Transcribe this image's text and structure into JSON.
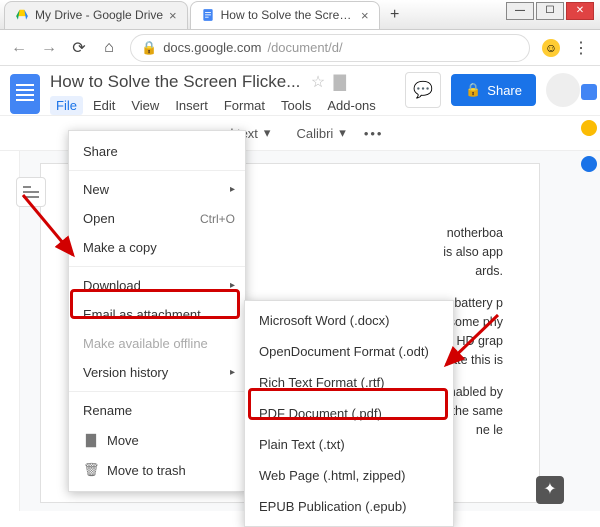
{
  "window": {
    "tabs": [
      {
        "title": "My Drive - Google Drive"
      },
      {
        "title": "How to Solve the Screen Flick"
      }
    ],
    "url_host": "docs.google.com",
    "url_path": "/document/d/"
  },
  "doc": {
    "title": "How to Solve the Screen Flicke...",
    "menus": [
      "File",
      "Edit",
      "View",
      "Insert",
      "Format",
      "Tools",
      "Add-ons"
    ],
    "share": "Share",
    "toolbar_style": "nal text",
    "toolbar_font": "Calibri"
  },
  "filemenu": {
    "share": "Share",
    "new": "New",
    "open": "Open",
    "open_shortcut": "Ctrl+O",
    "copy": "Make a copy",
    "download": "Download",
    "email": "Email as attachment",
    "offline": "Make available offline",
    "history": "Version history",
    "rename": "Rename",
    "move": "Move",
    "trash": "Move to trash"
  },
  "submenu": {
    "items": [
      "Microsoft Word (.docx)",
      "OpenDocument Format (.odt)",
      "Rich Text Format (.rtf)",
      "PDF Document (.pdf)",
      "Plain Text (.txt)",
      "Web Page (.html, zipped)",
      "EPUB Publication (.epub)"
    ]
  },
  "page_text": {
    "p1": "notherboa",
    "p2": "is also app",
    "p3": "ards.",
    "p4": "battery p",
    "p5": "some phy",
    "p6": "el HD grap",
    "p7": "date this is",
    "p8": "enabled by",
    "p9": "n the same",
    "p10": "ne le"
  }
}
